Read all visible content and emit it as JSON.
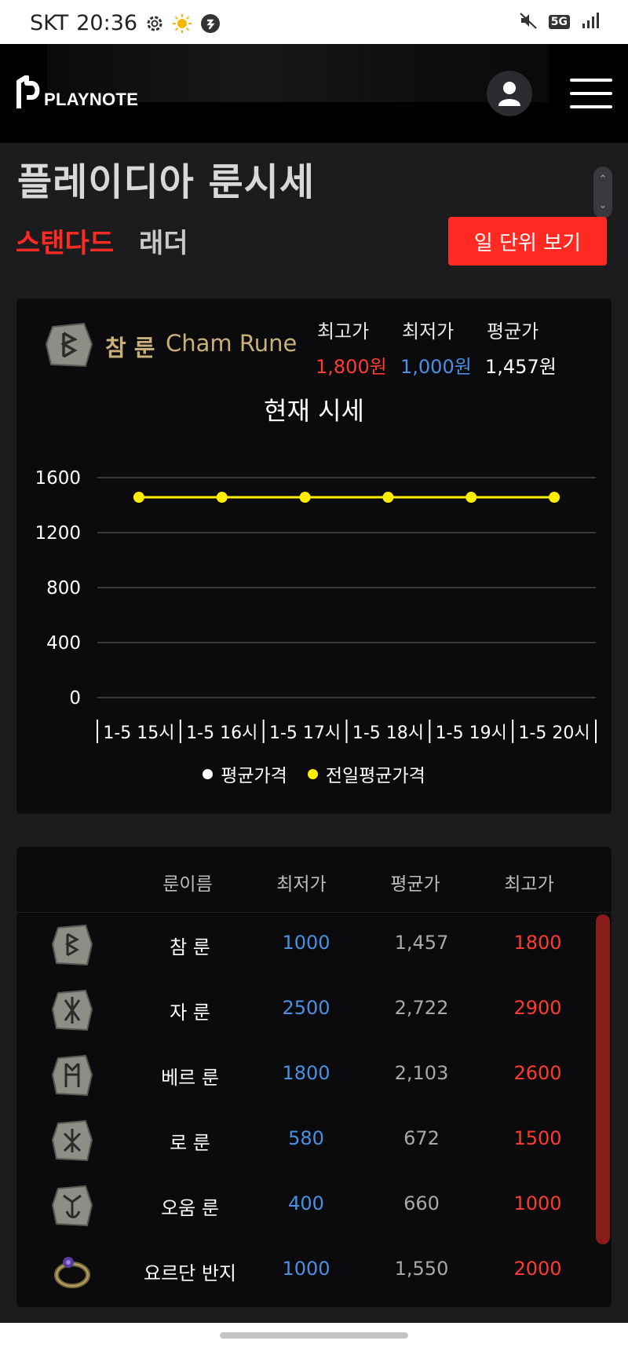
{
  "status_bar": {
    "carrier": "SKT",
    "time": "20:36",
    "network": "5G"
  },
  "header": {
    "logo_text": "PLAYNOTE"
  },
  "page": {
    "title": "플레이디아 룬시세"
  },
  "tabs": {
    "standard": "스탠다드",
    "ladder": "래더"
  },
  "actions": {
    "day_view": "일 단위 보기"
  },
  "summary": {
    "rune_name_ko": "참 룬",
    "rune_name_en": "Cham Rune",
    "max_label": "최고가",
    "max_value": "1,800원",
    "min_label": "최저가",
    "min_value": "1,000원",
    "avg_label": "평균가",
    "avg_value": "1,457원"
  },
  "chart_data": {
    "type": "line",
    "title": "현재 시세",
    "categories": [
      "1-5 15시",
      "1-5 16시",
      "1-5 17시",
      "1-5 18시",
      "1-5 19시",
      "1-5 20시"
    ],
    "series": [
      {
        "name": "평균가격",
        "color": "#ffffff",
        "values": [
          null,
          null,
          null,
          null,
          null,
          null
        ]
      },
      {
        "name": "전일평균가격",
        "color": "#ffee00",
        "values": [
          1457,
          1457,
          1457,
          1457,
          1457,
          1457
        ]
      }
    ],
    "yticks": [
      0,
      400,
      800,
      1200,
      1600
    ],
    "ylim": [
      0,
      1600
    ],
    "grid": true,
    "legend": "bottom"
  },
  "table": {
    "headers": {
      "name": "룬이름",
      "min": "최저가",
      "avg": "평균가",
      "max": "최고가"
    },
    "rows": [
      {
        "name": "참 룬",
        "min": "1000",
        "avg": "1,457",
        "max": "1800",
        "icon": "cham-rune-icon"
      },
      {
        "name": "자 룬",
        "min": "2500",
        "avg": "2,722",
        "max": "2900",
        "icon": "jah-rune-icon"
      },
      {
        "name": "베르 룬",
        "min": "1800",
        "avg": "2,103",
        "max": "2600",
        "icon": "ber-rune-icon"
      },
      {
        "name": "로 룬",
        "min": "580",
        "avg": "672",
        "max": "1500",
        "icon": "lo-rune-icon"
      },
      {
        "name": "오움 룬",
        "min": "400",
        "avg": "660",
        "max": "1000",
        "icon": "ohm-rune-icon"
      },
      {
        "name": "요르단 반지",
        "min": "1000",
        "avg": "1,550",
        "max": "2000",
        "icon": "jordan-ring-icon"
      }
    ]
  },
  "colors": {
    "accent": "#ff2b22",
    "min_price": "#4a90e2",
    "max_price": "#ff3b30",
    "rune_gold": "#c9b07a"
  }
}
